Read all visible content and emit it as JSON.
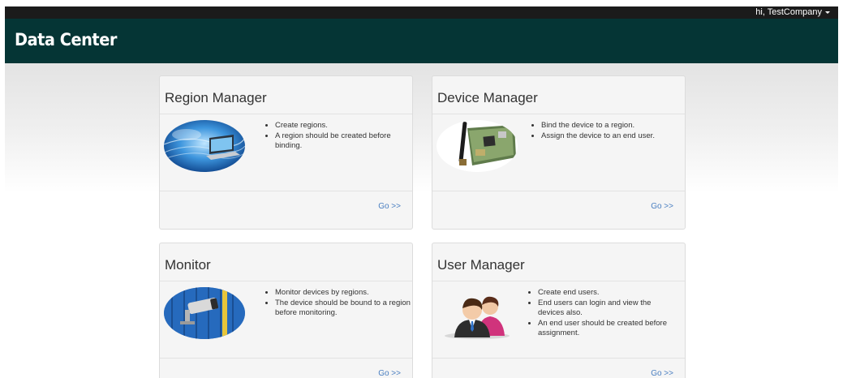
{
  "topbar": {
    "user_label": "hi,  TestCompany"
  },
  "header": {
    "brand": "Data Center"
  },
  "cards": [
    {
      "title": "Region Manager",
      "image": "cloud-laptop-image",
      "bullets": [
        "Create regions.",
        "A region should be created before binding."
      ],
      "link": "Go >>"
    },
    {
      "title": "Device Manager",
      "image": "circuit-board-image",
      "bullets": [
        "Bind the device to a region.",
        "Assign the device to an end user."
      ],
      "link": "Go >>"
    },
    {
      "title": "Monitor",
      "image": "security-camera-image",
      "bullets": [
        "Monitor devices by regions.",
        "The device should be bound to a region before monitoring."
      ],
      "link": "Go >>"
    },
    {
      "title": "User Manager",
      "image": "users-image",
      "bullets": [
        "Create end users.",
        "End users can login and view the devices also.",
        "An end user should be created before assignment."
      ],
      "link": "Go >>"
    }
  ],
  "colors": {
    "topbar": "#1b1b1b",
    "header": "#053535",
    "link": "#4a7fc1",
    "card_bg": "#f5f5f5"
  }
}
